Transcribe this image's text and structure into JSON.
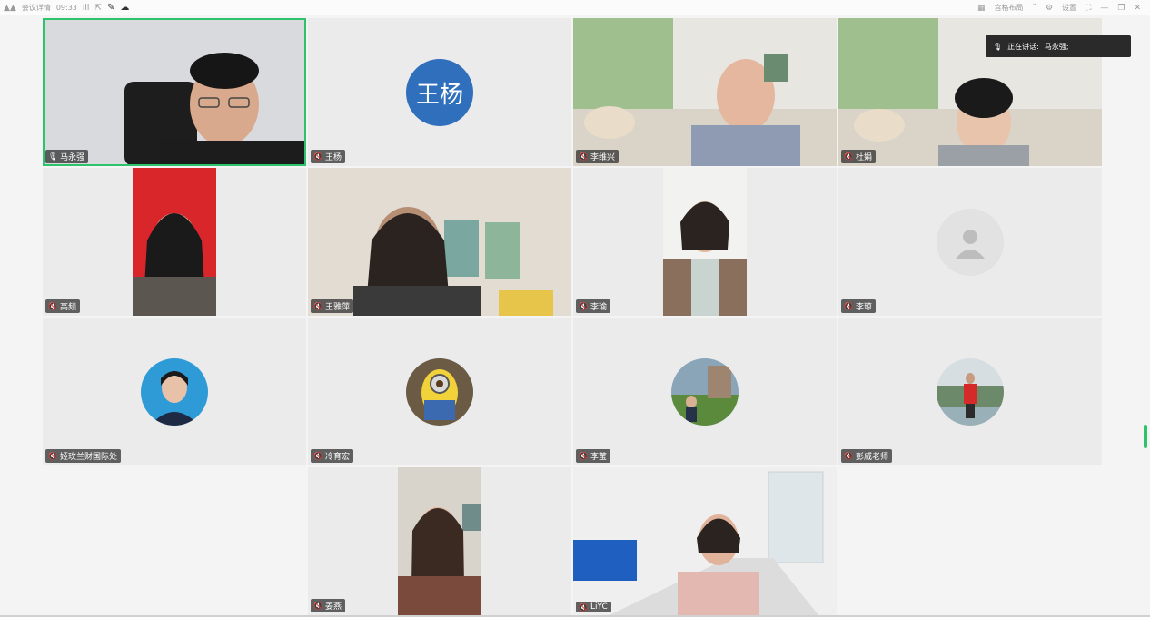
{
  "topbar": {
    "app_label": "会议详情",
    "time": "09:33",
    "layout_label": "宫格布局",
    "settings_label": "设置"
  },
  "speaking": {
    "label": "正在讲话:",
    "speaker": "马永强;"
  },
  "participants": [
    {
      "name": "马永强",
      "mic": "on"
    },
    {
      "name": "王杨",
      "mic": "muted",
      "avatar_text": "王杨"
    },
    {
      "name": "李维兴",
      "mic": "muted"
    },
    {
      "name": "杜娟",
      "mic": "muted"
    },
    {
      "name": "高频",
      "mic": "muted"
    },
    {
      "name": "王雅萍",
      "mic": "muted"
    },
    {
      "name": "李瑜",
      "mic": "muted"
    },
    {
      "name": "李琼",
      "mic": "muted"
    },
    {
      "name": "姬玫兰财国际处",
      "mic": "muted"
    },
    {
      "name": "冷育宏",
      "mic": "muted"
    },
    {
      "name": "李莹",
      "mic": "muted"
    },
    {
      "name": "彭威老师",
      "mic": "muted"
    },
    {
      "name": "姜燕",
      "mic": "muted"
    },
    {
      "name": "LiYC",
      "mic": "muted"
    }
  ],
  "colors": {
    "active_border": "#2cc36b",
    "avatar_blue": "#2f6fbc"
  }
}
